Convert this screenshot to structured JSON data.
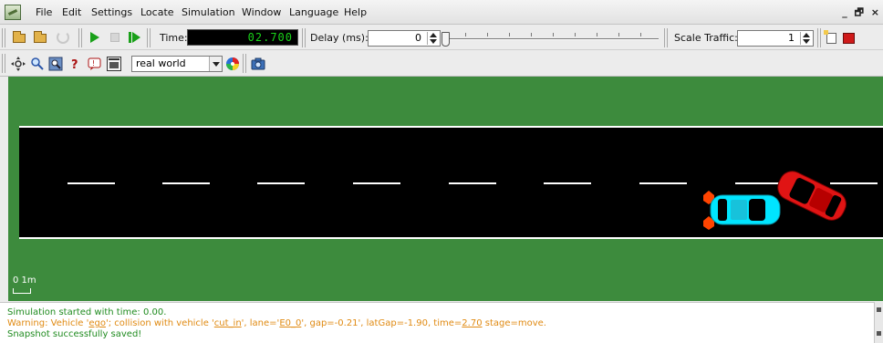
{
  "menubar": {
    "items": [
      {
        "label": "File"
      },
      {
        "label": "Edit"
      },
      {
        "label": "Settings"
      },
      {
        "label": "Locate"
      },
      {
        "label": "Simulation"
      },
      {
        "label": "Window"
      },
      {
        "label": "Language"
      },
      {
        "label": "Help"
      }
    ],
    "window_controls": "_ 🗗 ×"
  },
  "toolbar": {
    "time_label": "Time:",
    "time_value": "02.700",
    "delay_label": "Delay (ms):",
    "delay_value": "0",
    "delay_slider_fraction": 0,
    "scale_label": "Scale Traffic:",
    "scale_value": "1"
  },
  "viewbar": {
    "scheme_selected": "real world"
  },
  "scene": {
    "scale_label": "0   1m",
    "colors": {
      "grass": "#3d8b3d",
      "road": "#000000",
      "ego_vehicle": "#00e5ff",
      "cut_in_vehicle": "#e01414",
      "collision_marker": "#ff4400"
    }
  },
  "log": {
    "line1": "Simulation started with time: 0.00.",
    "warn_prefix": "Warning: Vehicle '",
    "warn_vehicle": "ego",
    "warn_mid1": "'; collision with vehicle '",
    "warn_other": "cut_in",
    "warn_mid2": "', lane='",
    "warn_lane": "E0_0",
    "warn_mid3": "', gap=-0.21', latGap=-1.90, time=",
    "warn_time": "2.70",
    "warn_suffix": " stage=move.",
    "line3": "Snapshot successfully saved!",
    "colors": {
      "message": "#1f8b1f",
      "warning": "#e08a12"
    }
  }
}
